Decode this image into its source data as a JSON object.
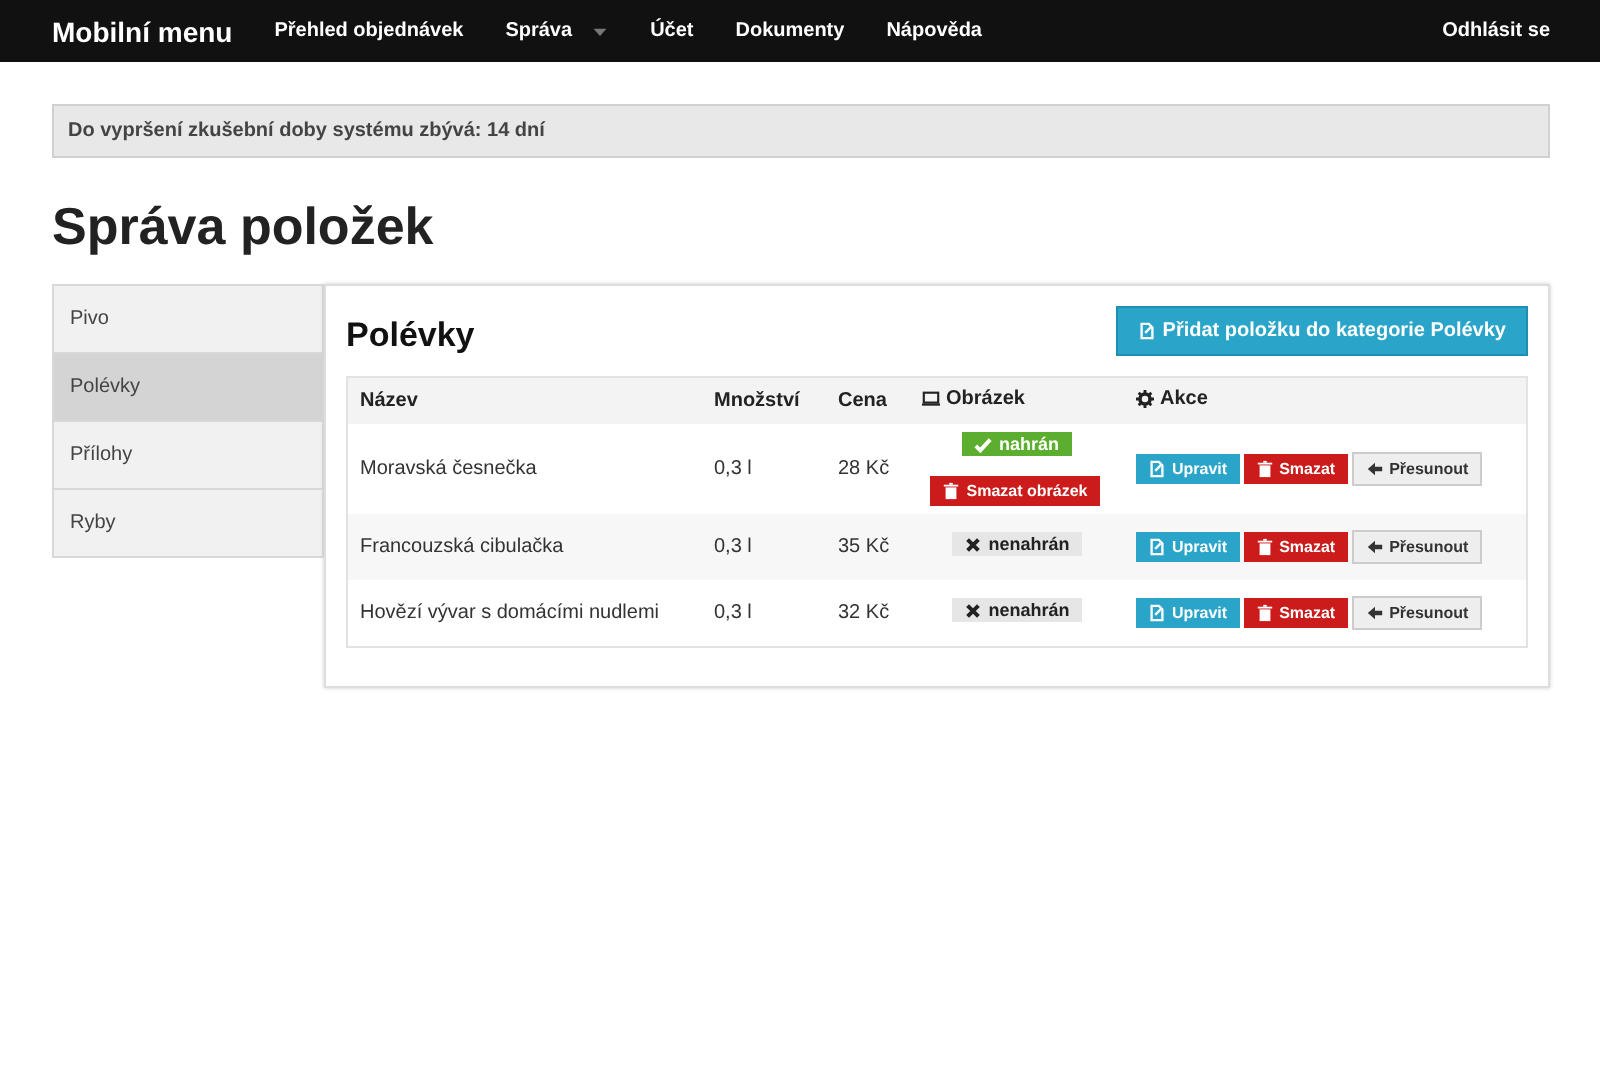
{
  "navbar": {
    "brand": "Mobilní menu",
    "items": [
      {
        "label": "Přehled objednávek",
        "dropdown": false
      },
      {
        "label": "Správa",
        "dropdown": true
      },
      {
        "label": "Účet",
        "dropdown": false
      },
      {
        "label": "Dokumenty",
        "dropdown": false
      },
      {
        "label": "Nápověda",
        "dropdown": false
      }
    ],
    "logout": "Odhlásit se"
  },
  "alert": "Do vypršení zkušební doby systému zbývá: 14 dní",
  "page_title": "Správa položek",
  "sidebar": {
    "items": [
      {
        "label": "Pivo",
        "selected": false
      },
      {
        "label": "Polévky",
        "selected": true
      },
      {
        "label": "Přílohy",
        "selected": false
      },
      {
        "label": "Ryby",
        "selected": false
      }
    ]
  },
  "panel": {
    "title": "Polévky",
    "add_button": "Přidat položku do kategorie Polévky",
    "table": {
      "columns": [
        "Název",
        "Množství",
        "Cena",
        "Obrázek",
        "Akce"
      ],
      "rows": [
        {
          "name": "Moravská česnečka",
          "amount": "0,3 l",
          "price": "28 Kč",
          "image": {
            "kind": "uploaded",
            "label": "nahrán",
            "delete": "Smazat obrázek"
          },
          "actions": [
            "Upravit",
            "Smazat",
            "Přesunout"
          ]
        },
        {
          "name": "Francouzská cibulačka",
          "amount": "0,3 l",
          "price": "35 Kč",
          "image": {
            "kind": "missing",
            "label": "nenahrán"
          },
          "actions": [
            "Upravit",
            "Smazat",
            "Přesunout"
          ]
        },
        {
          "name": "Hovězí vývar s domácími nudlemi",
          "amount": "0,3 l",
          "price": "32 Kč",
          "image": {
            "kind": "missing",
            "label": "nenahrán"
          },
          "actions": [
            "Upravit",
            "Smazat",
            "Přesunout"
          ]
        }
      ]
    }
  }
}
